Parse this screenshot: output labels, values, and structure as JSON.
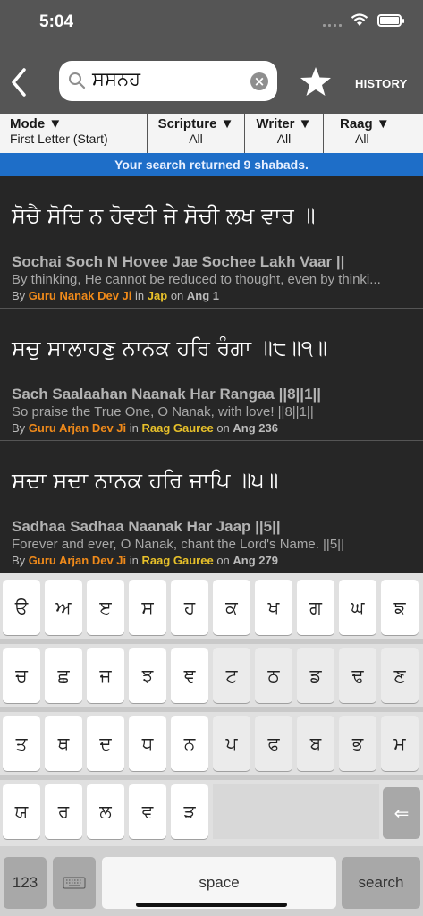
{
  "status": {
    "time": "5:04",
    "battery_level": 1.0
  },
  "header": {
    "search_query": "ਸਸਨਹ",
    "history_label": "HISTORY"
  },
  "filters": [
    {
      "title": "Mode ▼",
      "value": "First Letter (Start)"
    },
    {
      "title": "Scripture ▼",
      "value": "All"
    },
    {
      "title": "Writer ▼",
      "value": "All"
    },
    {
      "title": "Raag ▼",
      "value": "All"
    }
  ],
  "banner": "Your search returned 9 shabads.",
  "results": [
    {
      "gurmukhi": "ਸੋਚੈ ਸੋਚਿ ਨ ਹੋਵਈ ਜੇ ਸੋਚੀ ਲਖ ਵਾਰ ॥",
      "transliteration": "Sochai Soch N Hovee Jae Sochee Lakh Vaar ||",
      "translation": "By thinking, He cannot be reduced to thought, even by thinki...",
      "by": "By",
      "writer": "Guru Nanak Dev Ji",
      "in": "in",
      "source": "Jap",
      "on": "on",
      "ang": "Ang 1"
    },
    {
      "gurmukhi": "ਸਚੁ ਸਾਲਾਹਣੁ ਨਾਨਕ ਹਰਿ ਰੰਗਾ ॥੮॥੧॥",
      "transliteration": "Sach Saalaahan Naanak Har Rangaa ||8||1||",
      "translation": "So praise the True One, O Nanak, with love! ||8||1||",
      "by": "By",
      "writer": "Guru Arjan Dev Ji",
      "in": "in",
      "source": "Raag Gauree",
      "on": "on",
      "ang": "Ang 236"
    },
    {
      "gurmukhi": "ਸਦਾ ਸਦਾ ਨਾਨਕ ਹਰਿ ਜਾਪਿ ॥੫॥",
      "transliteration": "Sadhaa Sadhaa Naanak Har Jaap ||5||",
      "translation": "Forever and ever, O Nanak, chant the Lord's Name. ||5||",
      "by": "By",
      "writer": "Guru Arjan Dev Ji",
      "in": "in",
      "source": "Raag Gauree",
      "on": "on",
      "ang": "Ang 279"
    }
  ],
  "keyboard": {
    "rows": [
      [
        "ੳ",
        "ਅ",
        "ੲ",
        "ਸ",
        "ਹ",
        "ਕ",
        "ਖ",
        "ਗ",
        "ਘ",
        "ਙ"
      ],
      [
        "ਚ",
        "ਛ",
        "ਜ",
        "ਝ",
        "ਞ",
        "ਟ",
        "ਠ",
        "ਡ",
        "ਢ",
        "ਣ"
      ],
      [
        "ਤ",
        "ਥ",
        "ਦ",
        "ਧ",
        "ਨ",
        "ਪ",
        "ਫ",
        "ਬ",
        "ਭ",
        "ਮ"
      ],
      [
        "ਯ",
        "ਰ",
        "ਲ",
        "ਵ",
        "ੜ"
      ]
    ],
    "backspace": "⇐",
    "numbers_label": "123",
    "space_label": "space",
    "search_label": "search"
  }
}
